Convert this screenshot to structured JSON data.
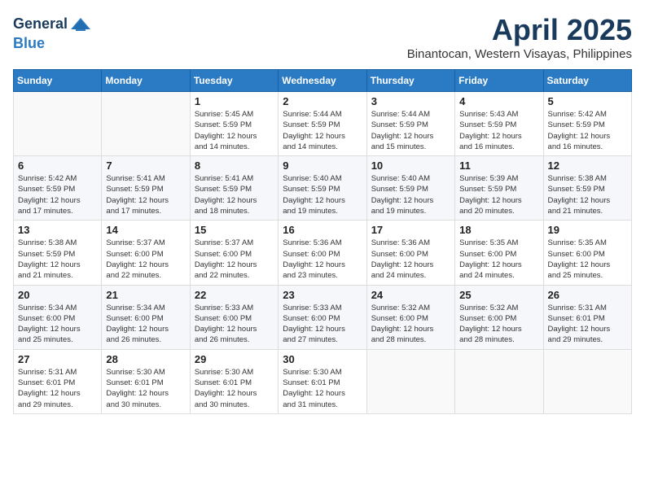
{
  "header": {
    "logo_line1": "General",
    "logo_line2": "Blue",
    "month_title": "April 2025",
    "location": "Binantocan, Western Visayas, Philippines"
  },
  "calendar": {
    "days_of_week": [
      "Sunday",
      "Monday",
      "Tuesday",
      "Wednesday",
      "Thursday",
      "Friday",
      "Saturday"
    ],
    "weeks": [
      [
        {
          "day": "",
          "info": ""
        },
        {
          "day": "",
          "info": ""
        },
        {
          "day": "1",
          "info": "Sunrise: 5:45 AM\nSunset: 5:59 PM\nDaylight: 12 hours\nand 14 minutes."
        },
        {
          "day": "2",
          "info": "Sunrise: 5:44 AM\nSunset: 5:59 PM\nDaylight: 12 hours\nand 14 minutes."
        },
        {
          "day": "3",
          "info": "Sunrise: 5:44 AM\nSunset: 5:59 PM\nDaylight: 12 hours\nand 15 minutes."
        },
        {
          "day": "4",
          "info": "Sunrise: 5:43 AM\nSunset: 5:59 PM\nDaylight: 12 hours\nand 16 minutes."
        },
        {
          "day": "5",
          "info": "Sunrise: 5:42 AM\nSunset: 5:59 PM\nDaylight: 12 hours\nand 16 minutes."
        }
      ],
      [
        {
          "day": "6",
          "info": "Sunrise: 5:42 AM\nSunset: 5:59 PM\nDaylight: 12 hours\nand 17 minutes."
        },
        {
          "day": "7",
          "info": "Sunrise: 5:41 AM\nSunset: 5:59 PM\nDaylight: 12 hours\nand 17 minutes."
        },
        {
          "day": "8",
          "info": "Sunrise: 5:41 AM\nSunset: 5:59 PM\nDaylight: 12 hours\nand 18 minutes."
        },
        {
          "day": "9",
          "info": "Sunrise: 5:40 AM\nSunset: 5:59 PM\nDaylight: 12 hours\nand 19 minutes."
        },
        {
          "day": "10",
          "info": "Sunrise: 5:40 AM\nSunset: 5:59 PM\nDaylight: 12 hours\nand 19 minutes."
        },
        {
          "day": "11",
          "info": "Sunrise: 5:39 AM\nSunset: 5:59 PM\nDaylight: 12 hours\nand 20 minutes."
        },
        {
          "day": "12",
          "info": "Sunrise: 5:38 AM\nSunset: 5:59 PM\nDaylight: 12 hours\nand 21 minutes."
        }
      ],
      [
        {
          "day": "13",
          "info": "Sunrise: 5:38 AM\nSunset: 5:59 PM\nDaylight: 12 hours\nand 21 minutes."
        },
        {
          "day": "14",
          "info": "Sunrise: 5:37 AM\nSunset: 6:00 PM\nDaylight: 12 hours\nand 22 minutes."
        },
        {
          "day": "15",
          "info": "Sunrise: 5:37 AM\nSunset: 6:00 PM\nDaylight: 12 hours\nand 22 minutes."
        },
        {
          "day": "16",
          "info": "Sunrise: 5:36 AM\nSunset: 6:00 PM\nDaylight: 12 hours\nand 23 minutes."
        },
        {
          "day": "17",
          "info": "Sunrise: 5:36 AM\nSunset: 6:00 PM\nDaylight: 12 hours\nand 24 minutes."
        },
        {
          "day": "18",
          "info": "Sunrise: 5:35 AM\nSunset: 6:00 PM\nDaylight: 12 hours\nand 24 minutes."
        },
        {
          "day": "19",
          "info": "Sunrise: 5:35 AM\nSunset: 6:00 PM\nDaylight: 12 hours\nand 25 minutes."
        }
      ],
      [
        {
          "day": "20",
          "info": "Sunrise: 5:34 AM\nSunset: 6:00 PM\nDaylight: 12 hours\nand 25 minutes."
        },
        {
          "day": "21",
          "info": "Sunrise: 5:34 AM\nSunset: 6:00 PM\nDaylight: 12 hours\nand 26 minutes."
        },
        {
          "day": "22",
          "info": "Sunrise: 5:33 AM\nSunset: 6:00 PM\nDaylight: 12 hours\nand 26 minutes."
        },
        {
          "day": "23",
          "info": "Sunrise: 5:33 AM\nSunset: 6:00 PM\nDaylight: 12 hours\nand 27 minutes."
        },
        {
          "day": "24",
          "info": "Sunrise: 5:32 AM\nSunset: 6:00 PM\nDaylight: 12 hours\nand 28 minutes."
        },
        {
          "day": "25",
          "info": "Sunrise: 5:32 AM\nSunset: 6:00 PM\nDaylight: 12 hours\nand 28 minutes."
        },
        {
          "day": "26",
          "info": "Sunrise: 5:31 AM\nSunset: 6:01 PM\nDaylight: 12 hours\nand 29 minutes."
        }
      ],
      [
        {
          "day": "27",
          "info": "Sunrise: 5:31 AM\nSunset: 6:01 PM\nDaylight: 12 hours\nand 29 minutes."
        },
        {
          "day": "28",
          "info": "Sunrise: 5:30 AM\nSunset: 6:01 PM\nDaylight: 12 hours\nand 30 minutes."
        },
        {
          "day": "29",
          "info": "Sunrise: 5:30 AM\nSunset: 6:01 PM\nDaylight: 12 hours\nand 30 minutes."
        },
        {
          "day": "30",
          "info": "Sunrise: 5:30 AM\nSunset: 6:01 PM\nDaylight: 12 hours\nand 31 minutes."
        },
        {
          "day": "",
          "info": ""
        },
        {
          "day": "",
          "info": ""
        },
        {
          "day": "",
          "info": ""
        }
      ]
    ]
  }
}
